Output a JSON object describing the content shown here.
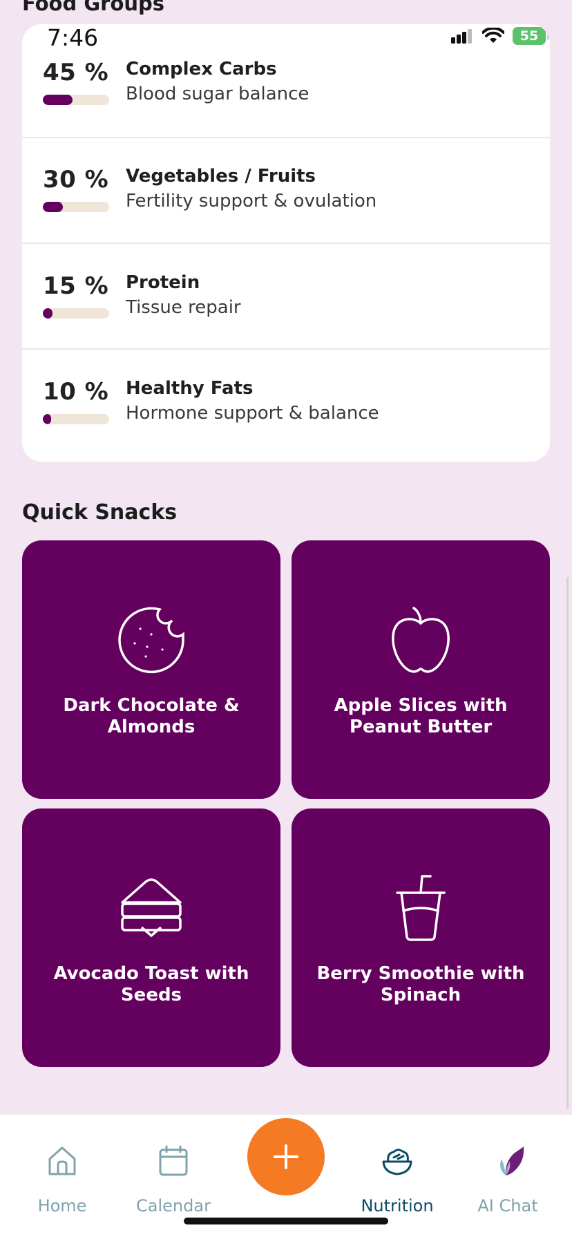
{
  "status_bar": {
    "time": "7:46",
    "battery": "55"
  },
  "food_groups": {
    "title": "Food Groups",
    "items": [
      {
        "percent": "45 %",
        "fill": 0.45,
        "name": "Complex Carbs",
        "description": "Blood sugar balance"
      },
      {
        "percent": "30 %",
        "fill": 0.3,
        "name": "Vegetables / Fruits",
        "description": "Fertility support & ovulation"
      },
      {
        "percent": "15 %",
        "fill": 0.15,
        "name": "Protein",
        "description": "Tissue repair"
      },
      {
        "percent": "10 %",
        "fill": 0.1,
        "name": "Healthy Fats",
        "description": "Hormone support & balance"
      }
    ]
  },
  "quick_snacks": {
    "title": "Quick Snacks",
    "items": [
      {
        "label": "Dark Chocolate & Almonds",
        "icon": "cookie-icon"
      },
      {
        "label": "Apple Slices with Peanut Butter",
        "icon": "apple-icon"
      },
      {
        "label": "Avocado Toast with Seeds",
        "icon": "sandwich-icon"
      },
      {
        "label": "Berry Smoothie with Spinach",
        "icon": "smoothie-cup-icon"
      }
    ]
  },
  "bottom_nav": {
    "items": [
      {
        "label": "Home",
        "icon": "home-icon",
        "active": false
      },
      {
        "label": "Calendar",
        "icon": "calendar-icon",
        "active": false
      },
      {
        "label": "Nutrition",
        "icon": "salad-bowl-icon",
        "active": true
      },
      {
        "label": "AI Chat",
        "icon": "leaf-logo-icon",
        "active": false
      }
    ],
    "add_icon": "plus-icon"
  },
  "colors": {
    "background": "#f3e5f1",
    "accent_purple": "#64005e",
    "fab_orange": "#f47a23",
    "nav_active": "#0d4a66",
    "nav_inactive": "#7fa3ad"
  }
}
